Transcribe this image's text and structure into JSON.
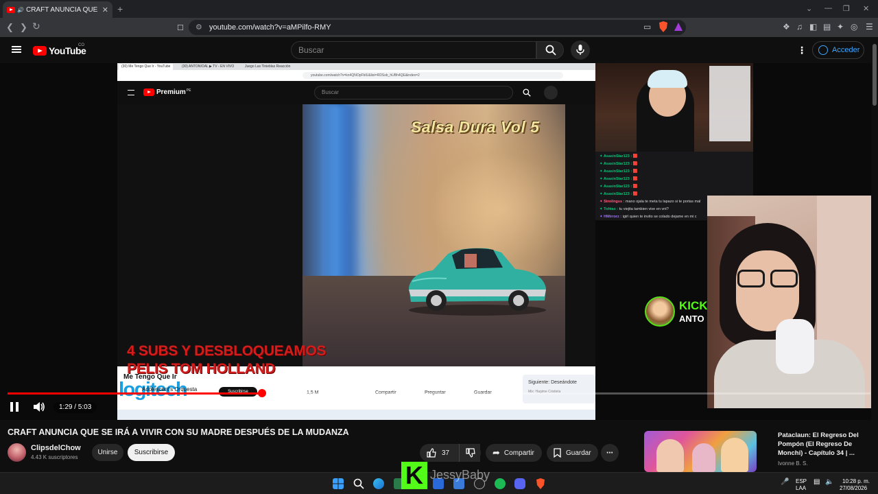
{
  "browser": {
    "tab_title": "CRAFT ANUNCIA QUE SE IRÁ",
    "new_tab": "+",
    "url": "youtube.com/watch?v=aMPilfo-RMY",
    "win_min": "⌄",
    "win_dash": "—",
    "win_max": "❐",
    "win_close": "✕"
  },
  "youtube": {
    "logo_text": "YouTube",
    "country": "CO",
    "search_placeholder": "Buscar",
    "signin_label": "Acceder"
  },
  "inner_screen": {
    "tab1": "(30) Me Tengo Que Ir - YouTube",
    "tab2": "(30) ANTONIOAL ▶ TV - EN VIVO",
    "tab3": "Juego Las Tinieblas Reacción",
    "url": "youtube.com/watch?v=kn4QNOpFbIU&list=RDSsb_hUBh4QE&index=2",
    "logo_text": "Premium",
    "logo_country": "PE",
    "search_placeholder": "Buscar",
    "album_title": "Salsa Dura Vol 5",
    "video_title": "Me Tengo Que Ir",
    "channel": "Adolescent's Orquesta",
    "subscribe": "Suscribirse",
    "likes": "1,5 M",
    "share": "Compartir",
    "ask": "Preguntar",
    "save": "Guardar",
    "next_label": "Siguiente: Deseándote",
    "next_sub": "Mix: Hagime Cristiela",
    "logitech": "logitech"
  },
  "overlay": {
    "line1": "4 SUBS Y DESBLOQUEAMOS",
    "line2": "PELIS TOM HOLLAND"
  },
  "kick": {
    "brand": "KICK",
    "name": "ANTO"
  },
  "chat": [
    {
      "user": "AsasinStar123 :",
      "msg": "🟥",
      "cls": "u"
    },
    {
      "user": "AsasinStar123 :",
      "msg": "🟥",
      "cls": "u"
    },
    {
      "user": "AsasinStar123 :",
      "msg": "🟥",
      "cls": "u"
    },
    {
      "user": "AsasinStar123 :",
      "msg": "🟥",
      "cls": "u"
    },
    {
      "user": "AsasinStar123 :",
      "msg": "🟥",
      "cls": "u"
    },
    {
      "user": "AsasinStar123 :",
      "msg": "🟥",
      "cls": "u"
    },
    {
      "user": "Strolingss :",
      "msg": "mano ojala te meta tu lapazo si te portas mal",
      "cls": "u2"
    },
    {
      "user": "Tohtas :",
      "msg": "tu viejita tambien vive en vnt?",
      "cls": "u"
    },
    {
      "user": "HMirrorz :",
      "msg": "igirl quien te invito se colado dejame en mi c",
      "cls": "u3"
    }
  ],
  "player": {
    "time": "1:29 / 5:03",
    "progress": 0.295
  },
  "video": {
    "title": "CRAFT ANUNCIA QUE SE IRÁ A VIVIR CON SU MADRE DESPUÉS DE LA MUDANZA",
    "channel": "ClipsdelChow",
    "subscribers": "4.43 K suscriptores",
    "join": "Unirse",
    "subscribe": "Suscribirse",
    "likes": "37",
    "share": "Compartir",
    "save": "Guardar"
  },
  "recommended": {
    "title": "Pataclaun: El Regreso Del Pompón (El Regreso De Monchi) - Capítulo 34 | ...",
    "channel": "Ivonne B. S."
  },
  "watermark": {
    "name": "JessyBaby"
  },
  "taskbar": {
    "lang": "ESP",
    "region": "LAA",
    "time": "10:28 p. m.",
    "date": "27/08/2026"
  }
}
